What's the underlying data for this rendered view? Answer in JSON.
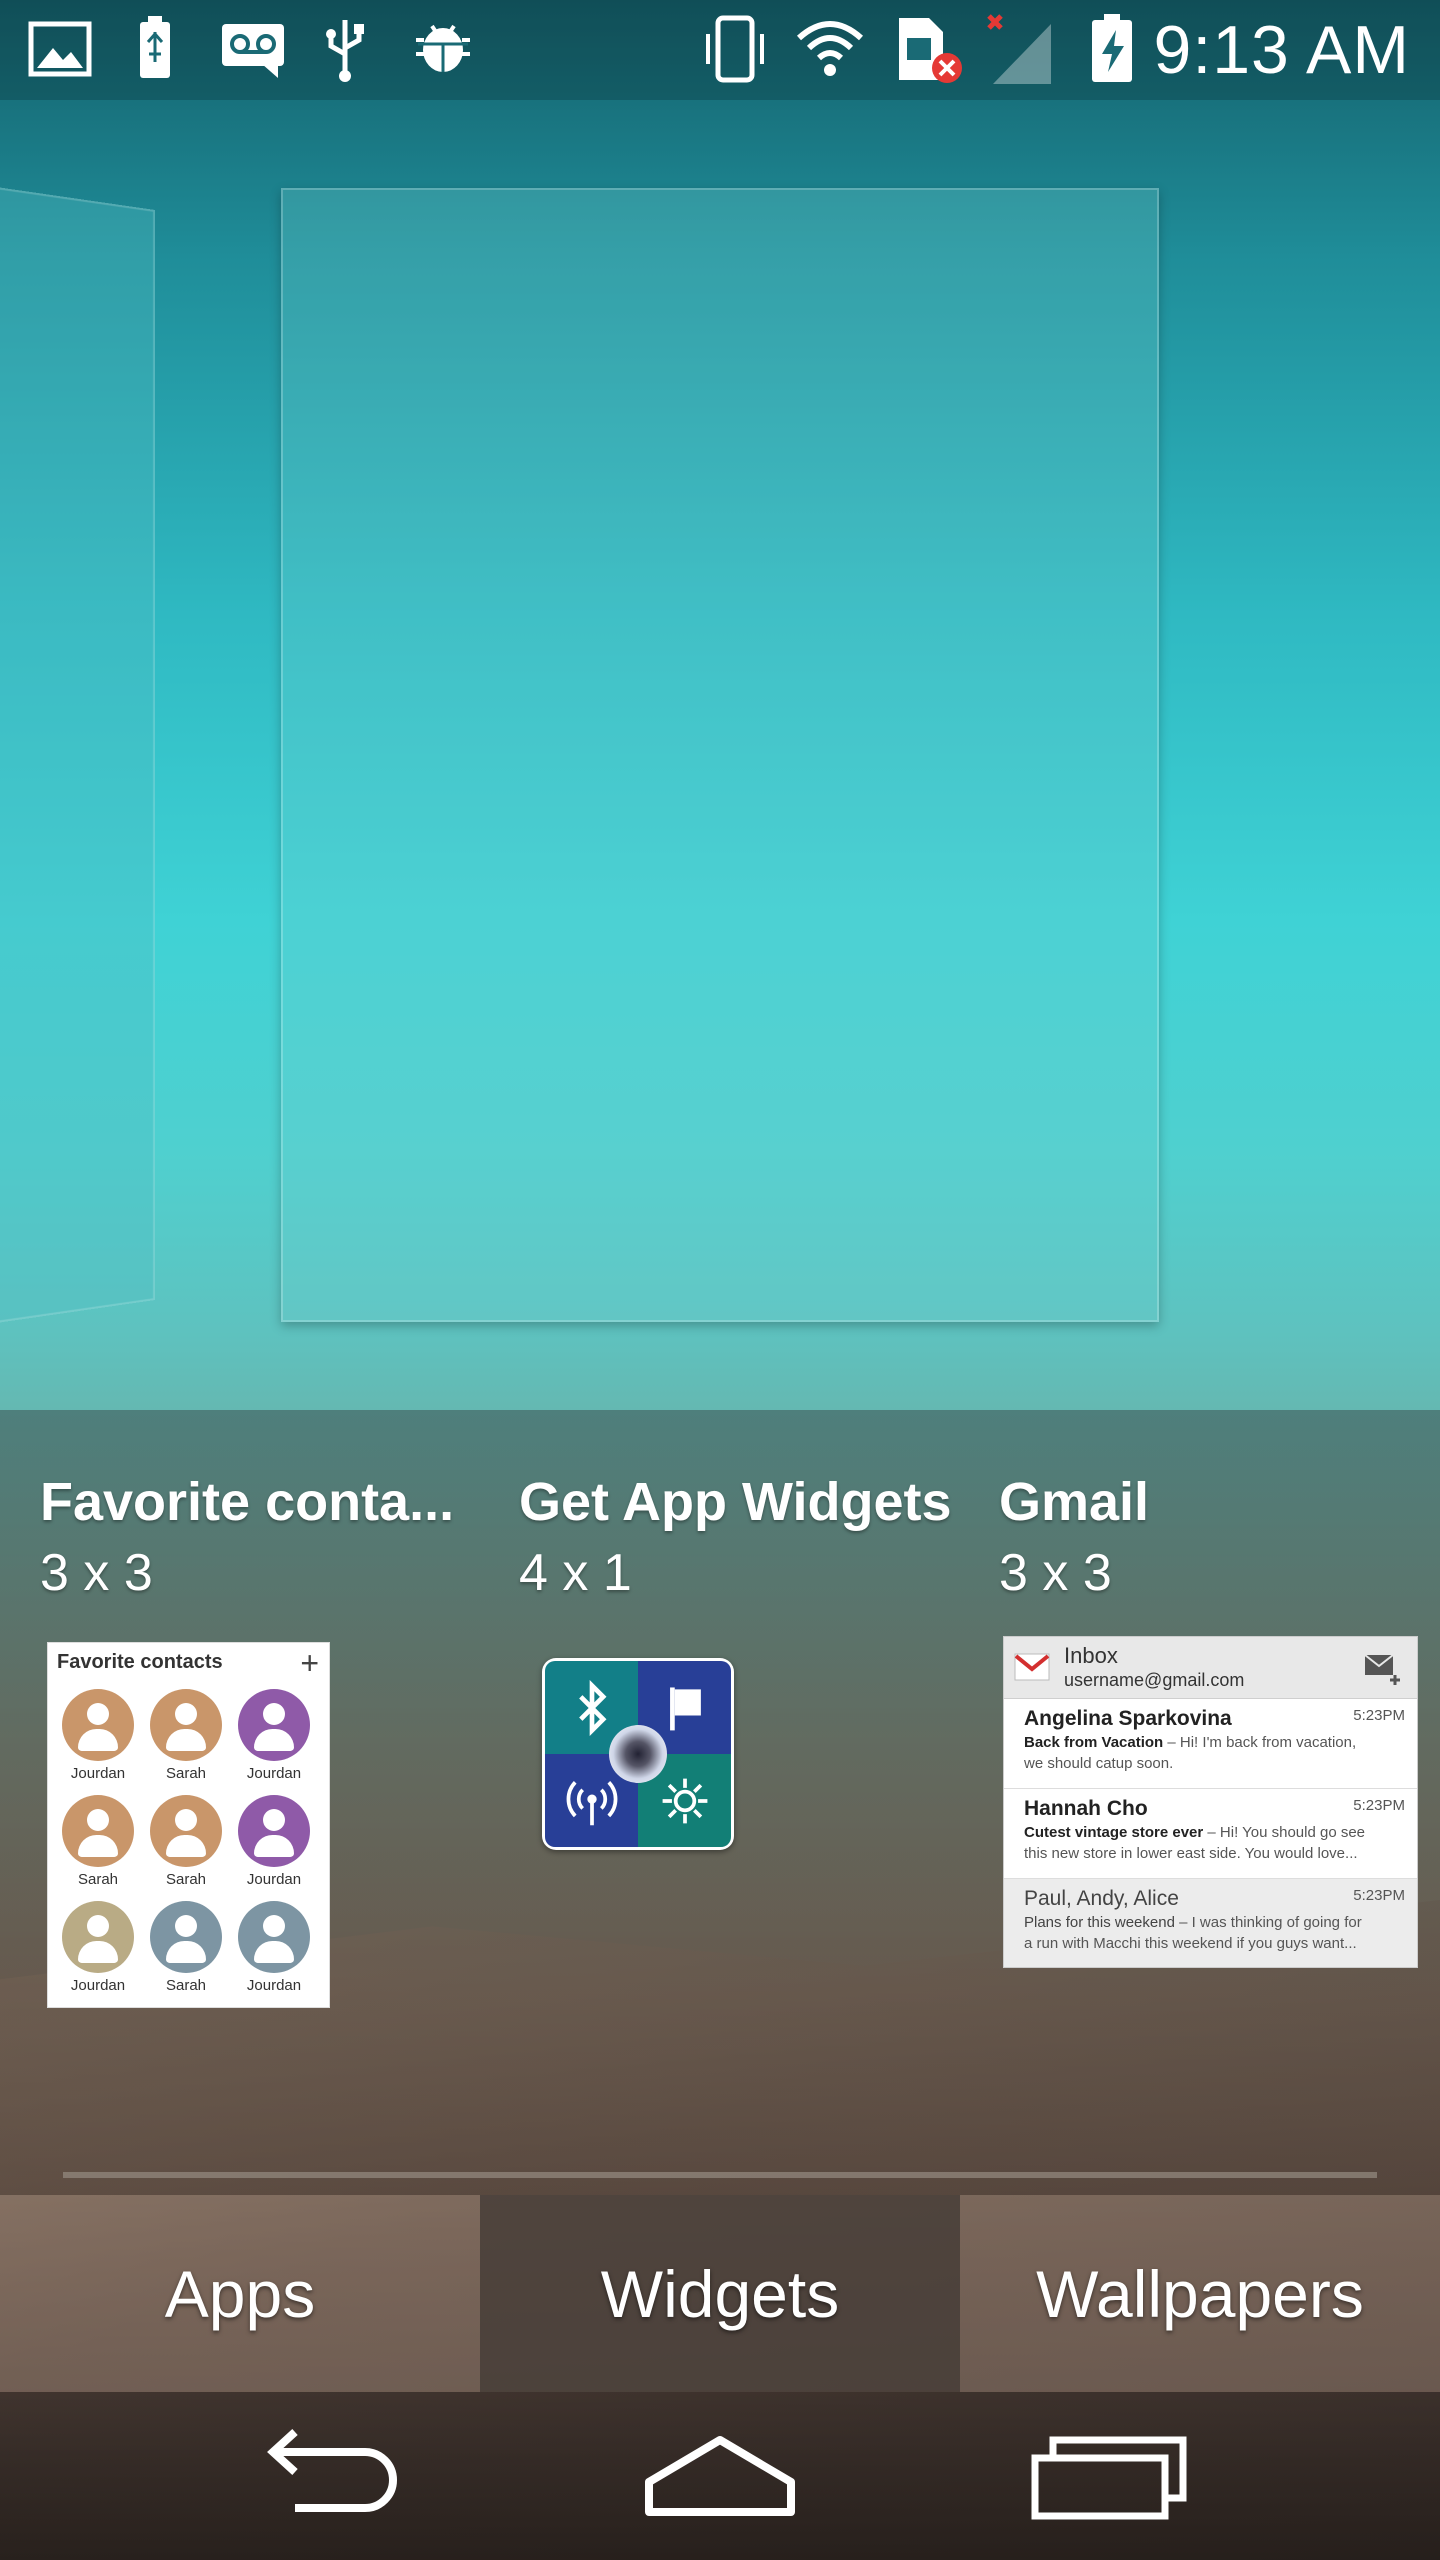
{
  "status_bar": {
    "time": "9:13 AM",
    "icons": [
      "image-icon",
      "usb-battery-icon",
      "voicemail-icon",
      "usb-icon",
      "android-debug-icon",
      "vibrate-icon",
      "wifi-icon",
      "sim-error-icon",
      "signal-icon",
      "battery-charging-icon"
    ]
  },
  "widgets": [
    {
      "title": "Favorite conta...",
      "size": "3 x 3",
      "preview": {
        "header": "Favorite contacts",
        "plus": "+",
        "contacts": [
          {
            "name": "Jourdan",
            "color": "#c9966a"
          },
          {
            "name": "Sarah",
            "color": "#c9966a"
          },
          {
            "name": "Jourdan",
            "color": "#8f5aa8"
          },
          {
            "name": "Sarah",
            "color": "#c9966a"
          },
          {
            "name": "Sarah",
            "color": "#c9966a"
          },
          {
            "name": "Jourdan",
            "color": "#8f5aa8"
          },
          {
            "name": "Jourdan",
            "color": "#b9ab85"
          },
          {
            "name": "Sarah",
            "color": "#7d95a3"
          },
          {
            "name": "Jourdan",
            "color": "#7d95a3"
          }
        ]
      }
    },
    {
      "title": "Get App Widgets",
      "size": "4 x 1",
      "preview": {
        "colors": [
          "#127f88",
          "#283f97",
          "#283f97",
          "#127f76"
        ]
      }
    },
    {
      "title": "Gmail",
      "size": "3 x 3",
      "preview": {
        "inbox": "Inbox",
        "account": "username@gmail.com",
        "messages": [
          {
            "sender": "Angelina Sparkovina",
            "time": "5:23PM",
            "subject": "Back from Vacation",
            "snippet": " – Hi! I'm back from vacation,",
            "snippet2": "we should catup soon."
          },
          {
            "sender": "Hannah Cho",
            "time": "5:23PM",
            "subject": "Cutest vintage store ever",
            "snippet": " – Hi! You should go see",
            "snippet2": "this new store in lower east side. You would love..."
          },
          {
            "sender": "Paul, Andy, Alice",
            "time": "5:23PM",
            "subject": "Plans for this weekend",
            "snippet": " – I was thinking of going for",
            "snippet2": "a run with Macchi this weekend if you guys want..."
          }
        ]
      }
    }
  ],
  "tabs": {
    "apps": "Apps",
    "widgets": "Widgets",
    "wallpapers": "Wallpapers",
    "selected": "Widgets"
  },
  "nav": [
    "back-icon",
    "home-icon",
    "recents-icon"
  ]
}
